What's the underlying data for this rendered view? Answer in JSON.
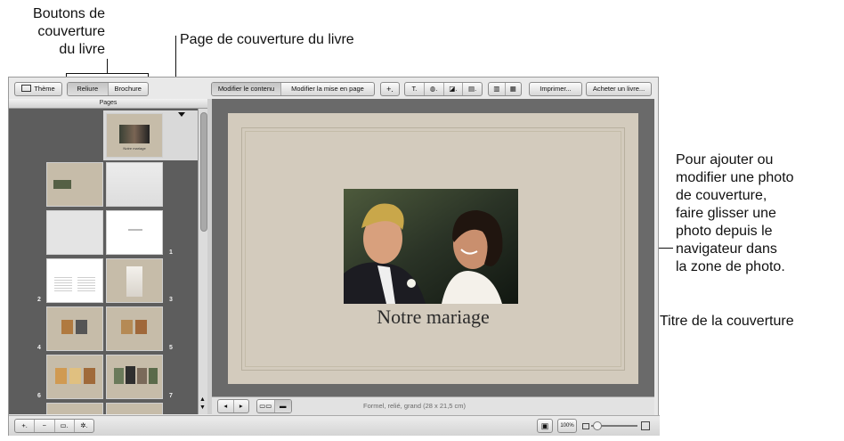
{
  "callouts": {
    "cover_buttons": "Boutons de\ncouverture\ndu livre",
    "cover_page": "Page de couverture du livre",
    "add_photo": "Pour ajouter ou\nmodifier une photo\nde couverture,\nfaire glisser une\nphoto depuis le\nnavigateur dans\nla zone de photo.",
    "cover_title": "Titre de la couverture"
  },
  "toolbar": {
    "theme": "Thème",
    "binding_options": [
      "Reliure",
      "Brochure"
    ],
    "binding_selected": "Reliure",
    "edit_modes": [
      "Modifier le contenu",
      "Modifier la mise en page"
    ],
    "edit_selected": "Modifier le contenu",
    "print": "Imprimer...",
    "buy": "Acheter un livre..."
  },
  "pages_panel": {
    "title": "Pages",
    "cover_caption": "Notre mariage",
    "page_numbers": [
      "1",
      "2",
      "3",
      "4",
      "5",
      "6",
      "7"
    ]
  },
  "book": {
    "cover_title": "Notre mariage",
    "format": "Formel, relié, grand (28 x 21,5 cm)"
  },
  "footer": {
    "zoom_label": "100%"
  },
  "colors": {
    "cover_linen": "#d3cbbd",
    "panel_dark": "#5d5d5d",
    "canvas_gray": "#6a6a6a"
  },
  "icons": [
    "theme-icon",
    "add-page-icon",
    "remove-page-icon",
    "layout-icon",
    "gear-icon",
    "text-icon",
    "add-icon",
    "prev-page-icon",
    "next-page-icon",
    "zoom-slider-icon"
  ]
}
